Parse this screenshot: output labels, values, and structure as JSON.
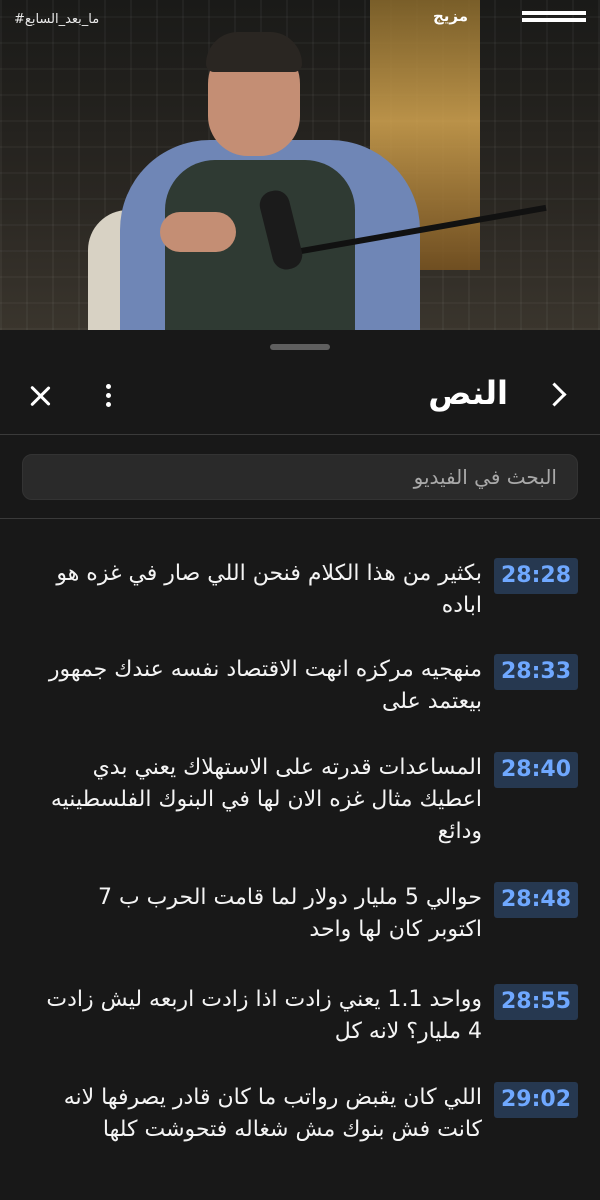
{
  "video": {
    "hashtag": "#ما_بعد_السابع",
    "logo_text": "مزيج"
  },
  "panel": {
    "title": "النص",
    "search_placeholder": "البحث في الفيديو"
  },
  "transcript": [
    {
      "time": "28:28",
      "text": "بكثير من هذا الكلام فنحن اللي صار في غزه هو اباده"
    },
    {
      "time": "28:33",
      "text": "منهجيه مركزه انهت الاقتصاد نفسه عندك جمهور بيعتمد على"
    },
    {
      "time": "28:40",
      "text": "المساعدات قدرته على الاستهلاك يعني بدي اعطيك مثال غزه الان لها في البنوك الفلسطينيه ودائع"
    },
    {
      "time": "28:48",
      "text": "حوالي 5 مليار دولار لما قامت الحرب ب 7 اكتوبر كان لها واحد"
    },
    {
      "time": "28:55",
      "text": "وواحد 1.1 يعني زادت اذا زادت اربعه ليش زادت 4 مليار؟ لانه كل"
    },
    {
      "time": "29:02",
      "text": "اللي كان يقبض رواتب ما كان قادر يصرفها لانه كانت فش بنوك مش شغاله فتحوشت كلها"
    }
  ]
}
